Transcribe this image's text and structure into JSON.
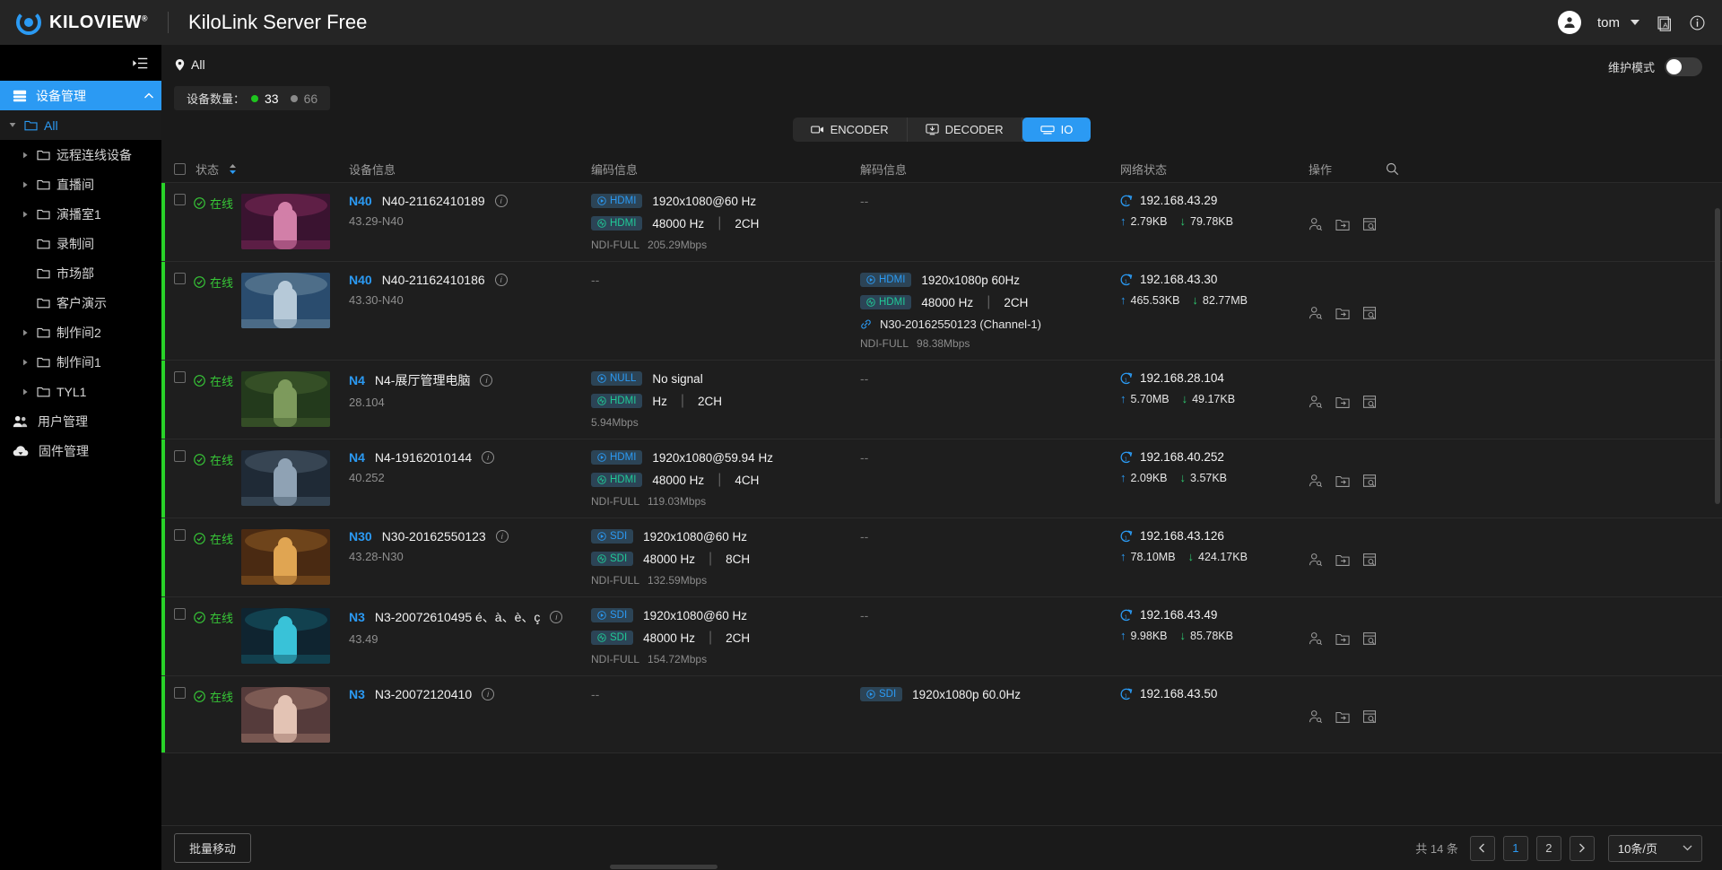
{
  "topbar": {
    "brand": "KILOVIEW",
    "brand_reg": "®",
    "app_title": "KiloLink Server Free",
    "user": "tom",
    "icons": [
      "avatar-icon",
      "chevron-down-icon",
      "language-icon",
      "info-icon"
    ]
  },
  "sidebar": {
    "collapse_icon": "collapse-panel-icon",
    "section": {
      "label": "设备管理",
      "icon": "server-icon"
    },
    "items": [
      {
        "label": "All",
        "level": 1,
        "arrow": "down",
        "selected": true
      },
      {
        "label": "远程连线设备",
        "level": 2,
        "arrow": "right",
        "selected": false
      },
      {
        "label": "直播间",
        "level": 2,
        "arrow": "right",
        "selected": false
      },
      {
        "label": "演播室1",
        "level": 2,
        "arrow": "right",
        "selected": false
      },
      {
        "label": "录制间",
        "level": 2,
        "arrow": "none",
        "selected": false
      },
      {
        "label": "市场部",
        "level": 2,
        "arrow": "none",
        "selected": false
      },
      {
        "label": "客户演示",
        "level": 2,
        "arrow": "none",
        "selected": false
      },
      {
        "label": "制作间2",
        "level": 2,
        "arrow": "right",
        "selected": false
      },
      {
        "label": "制作间1",
        "level": 2,
        "arrow": "right",
        "selected": false
      },
      {
        "label": "TYL1",
        "level": 2,
        "arrow": "right",
        "selected": false
      }
    ],
    "bottom_items": [
      {
        "label": "用户管理",
        "icon": "users-icon"
      },
      {
        "label": "固件管理",
        "icon": "cloud-upload-icon"
      }
    ]
  },
  "main": {
    "breadcrumb": "All",
    "breadcrumb_icon": "location-pin-icon",
    "maintenance": {
      "label": "维护模式",
      "on": false
    },
    "count_chip": {
      "label": "设备数量：",
      "online": "33",
      "offline": "66"
    },
    "tabs": [
      {
        "label": "ENCODER",
        "icon": "video-camera-icon",
        "active": false
      },
      {
        "label": "DECODER",
        "icon": "monitor-download-icon",
        "active": false
      },
      {
        "label": "IO",
        "icon": "io-device-icon",
        "active": true
      }
    ],
    "columns": {
      "status": "状态",
      "device": "设备信息",
      "encode": "编码信息",
      "decode": "解码信息",
      "network": "网络状态",
      "ops": "操作",
      "search_icon": "search-icon"
    },
    "rows": [
      {
        "online": true,
        "state": "在线",
        "model": "N40",
        "name": "N40-21162410189",
        "alias": "43.29-N40",
        "thumb_colors": [
          "#3a1330",
          "#d27fa8",
          "#7e2a5a"
        ],
        "encode": {
          "video_tag": "HDMI",
          "video_val": "1920x1080@60 Hz",
          "audio_tag": "HDMI",
          "audio_rate": "48000 Hz",
          "audio_ch": "2CH",
          "codec": "NDI-FULL",
          "bitrate": "205.29Mbps"
        },
        "decode": {
          "empty": "--"
        },
        "net": {
          "ip": "192.168.43.29",
          "up": "2.79KB",
          "down": "79.78KB"
        }
      },
      {
        "online": true,
        "state": "在线",
        "model": "N40",
        "name": "N40-21162410186",
        "alias": "43.30-N40",
        "thumb_colors": [
          "#2a4c6e",
          "#b6c9d8",
          "#6c8aa0"
        ],
        "encode": {
          "empty": "--"
        },
        "decode": {
          "video_tag": "HDMI",
          "video_val": "1920x1080p 60Hz",
          "audio_tag": "HDMI",
          "audio_rate": "48000 Hz",
          "audio_ch": "2CH",
          "link": "N30-20162550123 (Channel-1)",
          "codec": "NDI-FULL",
          "bitrate": "98.38Mbps"
        },
        "net": {
          "ip": "192.168.43.30",
          "up": "465.53KB",
          "down": "82.77MB"
        }
      },
      {
        "online": true,
        "state": "在线",
        "model": "N4",
        "name": "N4-展厅管理电脑",
        "alias": "28.104",
        "thumb_colors": [
          "#233a1c",
          "#7d9a5c",
          "#46602f"
        ],
        "encode": {
          "video_tag": "NULL",
          "video_val": "No signal",
          "audio_tag": "HDMI",
          "audio_rate": "Hz",
          "audio_ch": "2CH",
          "codec": "",
          "bitrate": "5.94Mbps"
        },
        "decode": {
          "empty": "--"
        },
        "net": {
          "ip": "192.168.28.104",
          "up": "5.70MB",
          "down": "49.17KB"
        }
      },
      {
        "online": true,
        "state": "在线",
        "model": "N4",
        "name": "N4-19162010144",
        "alias": "40.252",
        "thumb_colors": [
          "#1f2a36",
          "#8fa2b4",
          "#4a5b6b"
        ],
        "encode": {
          "video_tag": "HDMI",
          "video_val": "1920x1080@59.94 Hz",
          "audio_tag": "HDMI",
          "audio_rate": "48000 Hz",
          "audio_ch": "4CH",
          "codec": "NDI-FULL",
          "bitrate": "119.03Mbps"
        },
        "decode": {
          "empty": "--"
        },
        "net": {
          "ip": "192.168.40.252",
          "up": "2.09KB",
          "down": "3.57KB"
        }
      },
      {
        "online": true,
        "state": "在线",
        "model": "N30",
        "name": "N30-20162550123",
        "alias": "43.28-N30",
        "thumb_colors": [
          "#4a2a12",
          "#e0a552",
          "#8d5a22"
        ],
        "encode": {
          "video_tag": "SDI",
          "video_val": "1920x1080@60 Hz",
          "audio_tag": "SDI",
          "audio_rate": "48000 Hz",
          "audio_ch": "8CH",
          "codec": "NDI-FULL",
          "bitrate": "132.59Mbps"
        },
        "decode": {
          "empty": "--"
        },
        "net": {
          "ip": "192.168.43.126",
          "up": "78.10MB",
          "down": "424.17KB"
        }
      },
      {
        "online": true,
        "state": "在线",
        "model": "N3",
        "name": "N3-20072610495 é、à、è、ç",
        "alias": "43.49",
        "thumb_colors": [
          "#0f2430",
          "#39c2d8",
          "#155a6a"
        ],
        "encode": {
          "video_tag": "SDI",
          "video_val": "1920x1080@60 Hz",
          "audio_tag": "SDI",
          "audio_rate": "48000 Hz",
          "audio_ch": "2CH",
          "codec": "NDI-FULL",
          "bitrate": "154.72Mbps"
        },
        "decode": {
          "empty": "--"
        },
        "net": {
          "ip": "192.168.43.49",
          "up": "9.98KB",
          "down": "85.78KB"
        }
      },
      {
        "online": true,
        "state": "在线",
        "model": "N3",
        "name": "N3-20072120410",
        "alias": "",
        "thumb_colors": [
          "#553b3b",
          "#e3c3b4",
          "#9c7468"
        ],
        "encode": {
          "empty": "--"
        },
        "decode": {
          "video_tag": "SDI",
          "video_val": "1920x1080p 60.0Hz"
        },
        "net": {
          "ip": "192.168.43.50"
        }
      }
    ],
    "row_ops_icons": [
      "user-permission-icon",
      "move-to-folder-icon",
      "device-log-icon"
    ]
  },
  "footer": {
    "batch_move": "批量移动",
    "total": "共 14 条",
    "prev_icon": "chevron-left-icon",
    "next_icon": "chevron-right-icon",
    "pages": [
      "1",
      "2"
    ],
    "active_page": "1",
    "page_size": "10条/页"
  },
  "colors": {
    "accent": "#2b9af3",
    "online": "#29d329",
    "audio": "#20c997",
    "bg": "#1a1a1a"
  }
}
